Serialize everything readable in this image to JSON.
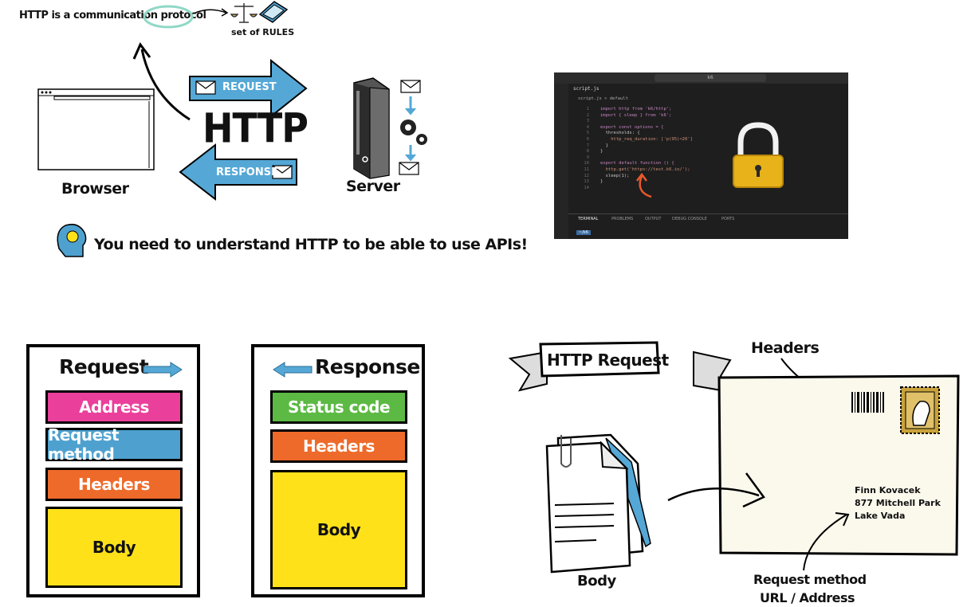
{
  "panel1": {
    "tagline": "HTTP is a communication protocol",
    "rules_label": "set of RULES",
    "http": "HTTP",
    "request_label": "REQUEST",
    "response_label": "RESPONSE",
    "browser_label": "Browser",
    "server_label": "Server",
    "understand": "You need to understand HTTP to be able to use APIs!"
  },
  "editor": {
    "search": "k6",
    "tab": "script.js",
    "breadcrumb": "script.js > default",
    "lines": [
      "import http from 'k6/http';",
      "import { sleep } from 'k6';",
      "",
      "export const options = {",
      "  thresholds: {",
      "    http_req_duration: ['p(95)<20']",
      "  }",
      "}",
      "",
      "export default function () {",
      "  http.get('https://test.k6.io/');",
      "  sleep(1);",
      "}",
      ""
    ],
    "panel_tabs": [
      "TERMINAL",
      "PROBLEMS",
      "OUTPUT",
      "DEBUG CONSOLE",
      "PORTS"
    ],
    "prompt": "~/k6"
  },
  "request_card": {
    "title": "Request",
    "blocks": [
      "Address",
      "Request method",
      "Headers",
      "Body"
    ]
  },
  "response_card": {
    "title": "Response",
    "blocks": [
      "Status code",
      "Headers",
      "Body"
    ]
  },
  "envelope": {
    "banner": "HTTP Request",
    "headers_label": "Headers",
    "body_label": "Body",
    "address": [
      "Finn Kovacek",
      "877 Mitchell Park",
      "Lake Vada"
    ],
    "method_label": "Request method",
    "url_label": "URL / Address"
  },
  "colors": {
    "arrow_blue": "#55a8d6",
    "address_pink": "#ea3f9b",
    "method_blue": "#4ea1cf",
    "headers_orange": "#ee6a2a",
    "body_yellow": "#ffe11a",
    "status_green": "#5cb944",
    "lock_gold": "#e8b21a"
  }
}
